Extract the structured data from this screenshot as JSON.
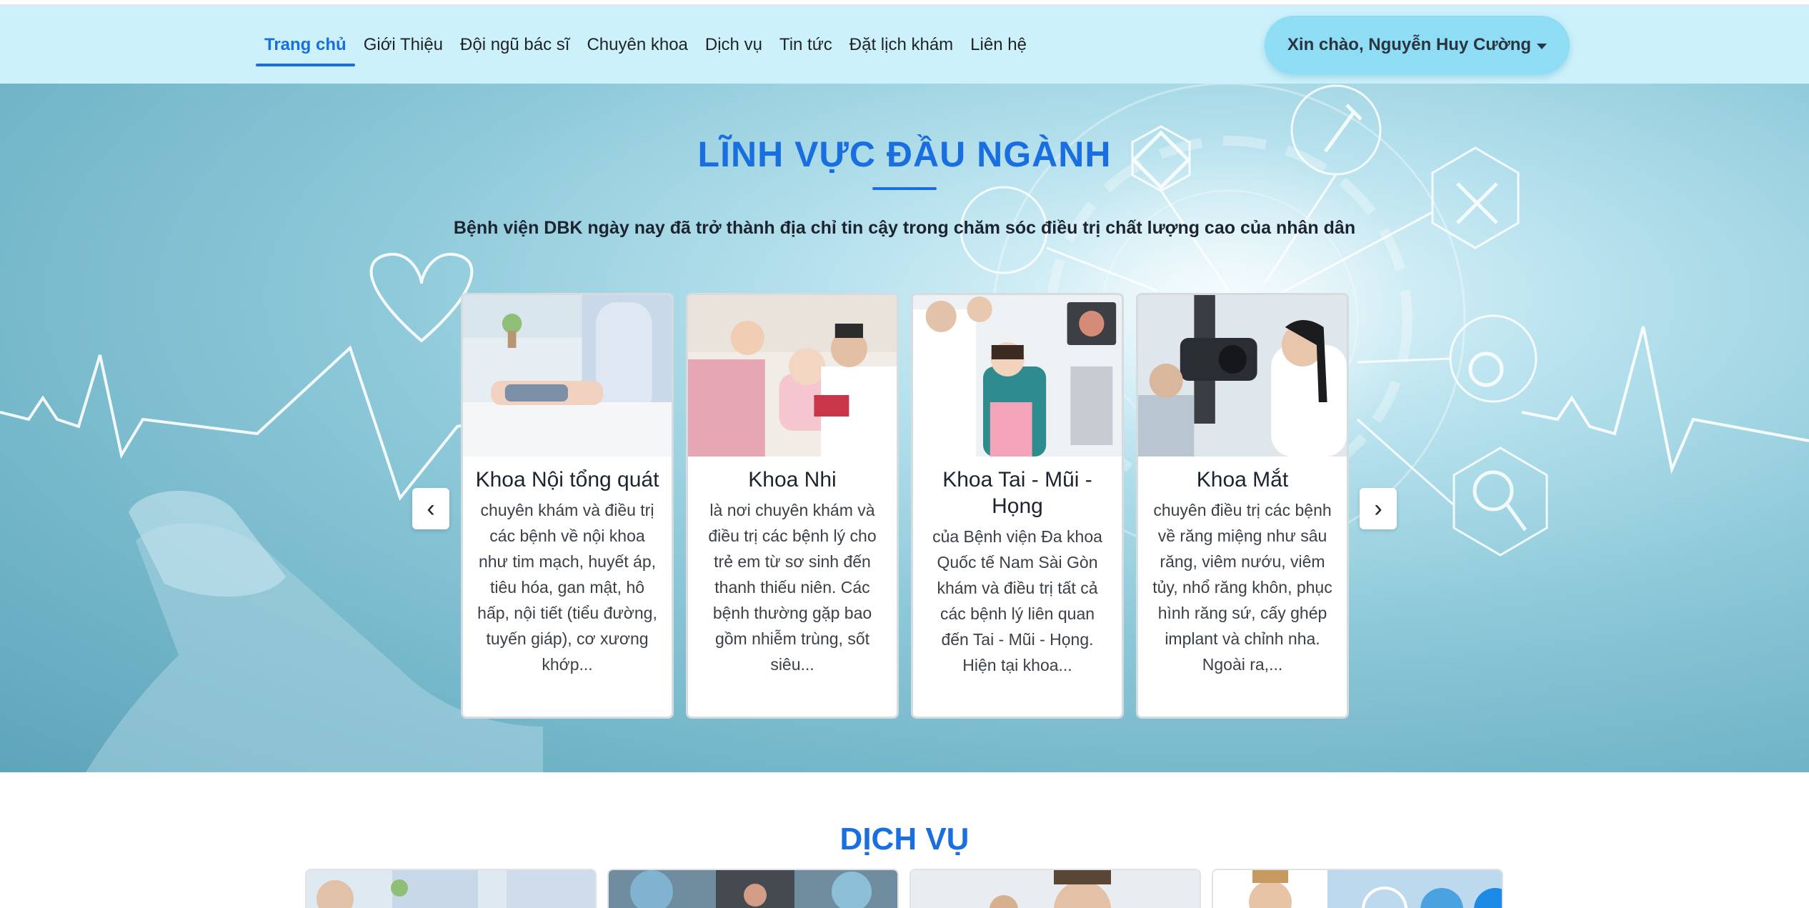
{
  "nav": {
    "links": [
      "Trang chủ",
      "Giới Thiệu",
      "Đội ngũ bác sĩ",
      "Chuyên khoa",
      "Dịch vụ",
      "Tin tức",
      "Đặt lịch khám",
      "Liên hệ"
    ],
    "active_index": 0,
    "user_greeting": "Xin chào, Nguyễn Huy Cường"
  },
  "hero": {
    "title": "LĨNH VỰC ĐẦU NGÀNH",
    "subtitle": "Bệnh viện DBK ngày nay đã trở thành địa chỉ tin cậy trong chăm sóc điều trị chất lượng cao của nhân dân",
    "prev_icon": "‹",
    "next_icon": "›",
    "cards": [
      {
        "title": "Khoa Nội tổng quát",
        "text": "chuyên khám và điều trị các bệnh về nội khoa như tim mạch, huyết áp, tiêu hóa, gan mật, hô hấp, nội tiết (tiểu đường, tuyến giáp), cơ xương khớp..."
      },
      {
        "title": "Khoa Nhi",
        "text": "là nơi chuyên khám và điều trị các bệnh lý cho trẻ em từ sơ sinh đến thanh thiếu niên. Các bệnh thường gặp bao gồm nhiễm trùng, sốt siêu..."
      },
      {
        "title": "Khoa Tai - Mũi - Họng",
        "text": "của Bệnh viện Đa khoa Quốc tế Nam Sài Gòn khám và điều trị tất cả các bệnh lý liên quan đến Tai - Mũi - Họng. Hiện tại khoa..."
      },
      {
        "title": "Khoa Mắt",
        "text": "chuyên điều trị các bệnh về răng miệng như sâu răng, viêm nướu, viêm tủy, nhổ răng khôn, phục hình răng sứ, cấy ghép implant và chỉnh nha. Ngoài ra,..."
      }
    ]
  },
  "services": {
    "title": "DỊCH VỤ"
  },
  "colors": {
    "accent": "#1a6fe0",
    "navbar_bg": "#cdf1fa",
    "user_button_bg": "#8fdcf5"
  }
}
